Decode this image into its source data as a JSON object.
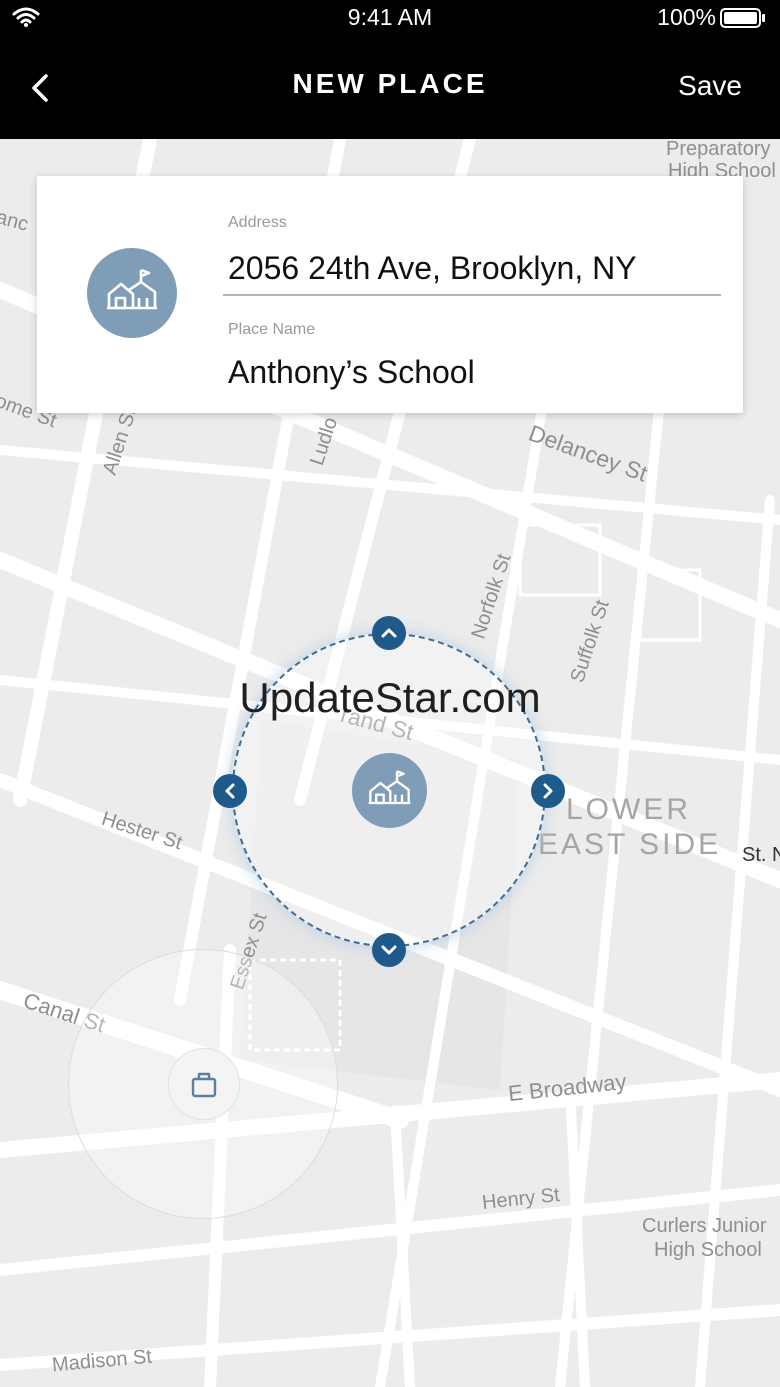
{
  "status_bar": {
    "time": "9:41 AM",
    "battery": "100%"
  },
  "nav": {
    "title": "NEW PLACE",
    "save_label": "Save"
  },
  "form": {
    "address_label": "Address",
    "address_value": "2056 24th Ave, Brooklyn, NY",
    "place_name_label": "Place Name",
    "place_name_value": "Anthony’s School"
  },
  "map": {
    "labels": {
      "prep_school_1": "Preparatory",
      "prep_school_2": "High School",
      "delancey": "Delancey St",
      "allen": "Allen St",
      "ludlow": "Ludlo",
      "norfolk": "Norfolk St",
      "suffolk": "Suffolk St",
      "grand": "rand St",
      "hester": "Hester St",
      "essex": "Essex St",
      "canal": "Canal St",
      "broadway": "E Broadway",
      "henry": "Henry St",
      "madison": "Madison St",
      "curlers_1": "Curlers Junior",
      "curlers_2": "High School",
      "lower": "LOWER",
      "east_side": "EAST SIDE",
      "st_n": "St. N",
      "broome": "ome St",
      "anc": "anc"
    }
  },
  "watermark": "UpdateStar.com",
  "colors": {
    "accent": "#1e5a8c",
    "avatar": "#7f9db7"
  }
}
